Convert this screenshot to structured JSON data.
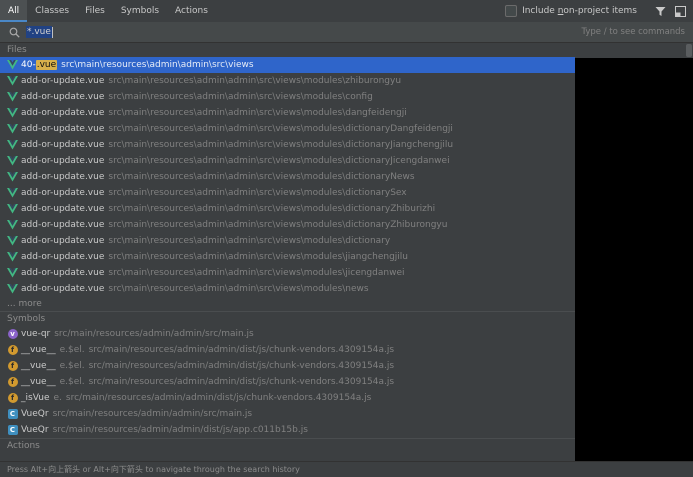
{
  "tabs": [
    "All",
    "Classes",
    "Files",
    "Symbols",
    "Actions"
  ],
  "include_label_prefix": "Include ",
  "include_label_mnemonic": "n",
  "include_label_suffix": "on-project items",
  "search": {
    "value": "*.vue",
    "hint": "Type / to see commands"
  },
  "sections": {
    "files": "Files",
    "symbols": "Symbols",
    "actions": "Actions"
  },
  "files": [
    {
      "prefix": "40-",
      "match": ".vue",
      "suffix": "",
      "path": "src\\main\\resources\\admin\\admin\\src\\views"
    },
    {
      "name": "add-or-update.vue",
      "path": "src\\main\\resources\\admin\\admin\\src\\views\\modules\\zhiburongyu"
    },
    {
      "name": "add-or-update.vue",
      "path": "src\\main\\resources\\admin\\admin\\src\\views\\modules\\config"
    },
    {
      "name": "add-or-update.vue",
      "path": "src\\main\\resources\\admin\\admin\\src\\views\\modules\\dangfeidengji"
    },
    {
      "name": "add-or-update.vue",
      "path": "src\\main\\resources\\admin\\admin\\src\\views\\modules\\dictionaryDangfeidengji"
    },
    {
      "name": "add-or-update.vue",
      "path": "src\\main\\resources\\admin\\admin\\src\\views\\modules\\dictionaryJiangchengjilu"
    },
    {
      "name": "add-or-update.vue",
      "path": "src\\main\\resources\\admin\\admin\\src\\views\\modules\\dictionaryJicengdanwei"
    },
    {
      "name": "add-or-update.vue",
      "path": "src\\main\\resources\\admin\\admin\\src\\views\\modules\\dictionaryNews"
    },
    {
      "name": "add-or-update.vue",
      "path": "src\\main\\resources\\admin\\admin\\src\\views\\modules\\dictionarySex"
    },
    {
      "name": "add-or-update.vue",
      "path": "src\\main\\resources\\admin\\admin\\src\\views\\modules\\dictionaryZhiburizhi"
    },
    {
      "name": "add-or-update.vue",
      "path": "src\\main\\resources\\admin\\admin\\src\\views\\modules\\dictionaryZhiburongyu"
    },
    {
      "name": "add-or-update.vue",
      "path": "src\\main\\resources\\admin\\admin\\src\\views\\modules\\dictionary"
    },
    {
      "name": "add-or-update.vue",
      "path": "src\\main\\resources\\admin\\admin\\src\\views\\modules\\jiangchengjilu"
    },
    {
      "name": "add-or-update.vue",
      "path": "src\\main\\resources\\admin\\admin\\src\\views\\modules\\jicengdanwei"
    },
    {
      "name": "add-or-update.vue",
      "path": "src\\main\\resources\\admin\\admin\\src\\views\\modules\\news"
    }
  ],
  "more_label": "... more",
  "symbols": [
    {
      "icon": "purple",
      "glyph": "v",
      "name": "vue-qr",
      "path": "src/main/resources/admin/admin/src/main.js"
    },
    {
      "icon": "orange",
      "glyph": "f",
      "name": "__vue__",
      "extra": "e.$el.",
      "path": "src/main/resources/admin/admin/dist/js/chunk-vendors.4309154a.js"
    },
    {
      "icon": "orange",
      "glyph": "f",
      "name": "__vue__",
      "extra": "e.$el.",
      "path": "src/main/resources/admin/admin/dist/js/chunk-vendors.4309154a.js"
    },
    {
      "icon": "orange",
      "glyph": "f",
      "name": "__vue__",
      "extra": "e.$el.",
      "path": "src/main/resources/admin/admin/dist/js/chunk-vendors.4309154a.js"
    },
    {
      "icon": "orange",
      "glyph": "f",
      "name": "_isVue",
      "extra": "e.",
      "path": "src/main/resources/admin/admin/dist/js/chunk-vendors.4309154a.js"
    },
    {
      "icon": "class",
      "glyph": "C",
      "name": "VueQr",
      "path": "src/main/resources/admin/admin/src/main.js"
    },
    {
      "icon": "class",
      "glyph": "C",
      "name": "VueQr",
      "path": "src/main/resources/admin/admin/dist/js/app.c011b15b.js"
    }
  ],
  "footer": "Press Alt+向上箭头 or Alt+向下箭头 to navigate through the search history",
  "colors": {
    "selection": "#2f65ca",
    "vue_green": "#42b883",
    "highlight": "#d8b04b"
  }
}
